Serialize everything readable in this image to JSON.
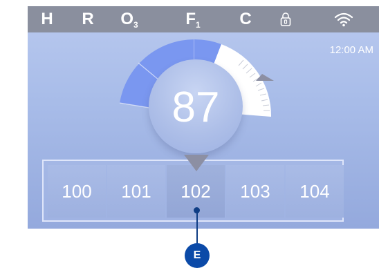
{
  "status_bar": {
    "items": [
      {
        "label": "H",
        "sub": ""
      },
      {
        "label": "R",
        "sub": ""
      },
      {
        "label": "O",
        "sub": "3"
      },
      {
        "label": "F",
        "sub": "1"
      },
      {
        "label": "C",
        "sub": ""
      }
    ],
    "lock_icon": "lock-icon",
    "wifi_icon": "wifi-icon"
  },
  "clock": "12:00 AM",
  "thermostat": {
    "current_temperature": "87",
    "set_point_indicator_icon": "triangle-left-icon",
    "selector_pointer_icon": "triangle-down-icon",
    "colors": {
      "blue_segment": "#7a97f0",
      "white_segment": "#ffffff",
      "indicator": "#8c8fa3"
    }
  },
  "temperature_options": [
    "100",
    "101",
    "102",
    "103",
    "104"
  ],
  "selected_option": "102",
  "callout": {
    "label": "E",
    "color": "#0b4aa8"
  }
}
